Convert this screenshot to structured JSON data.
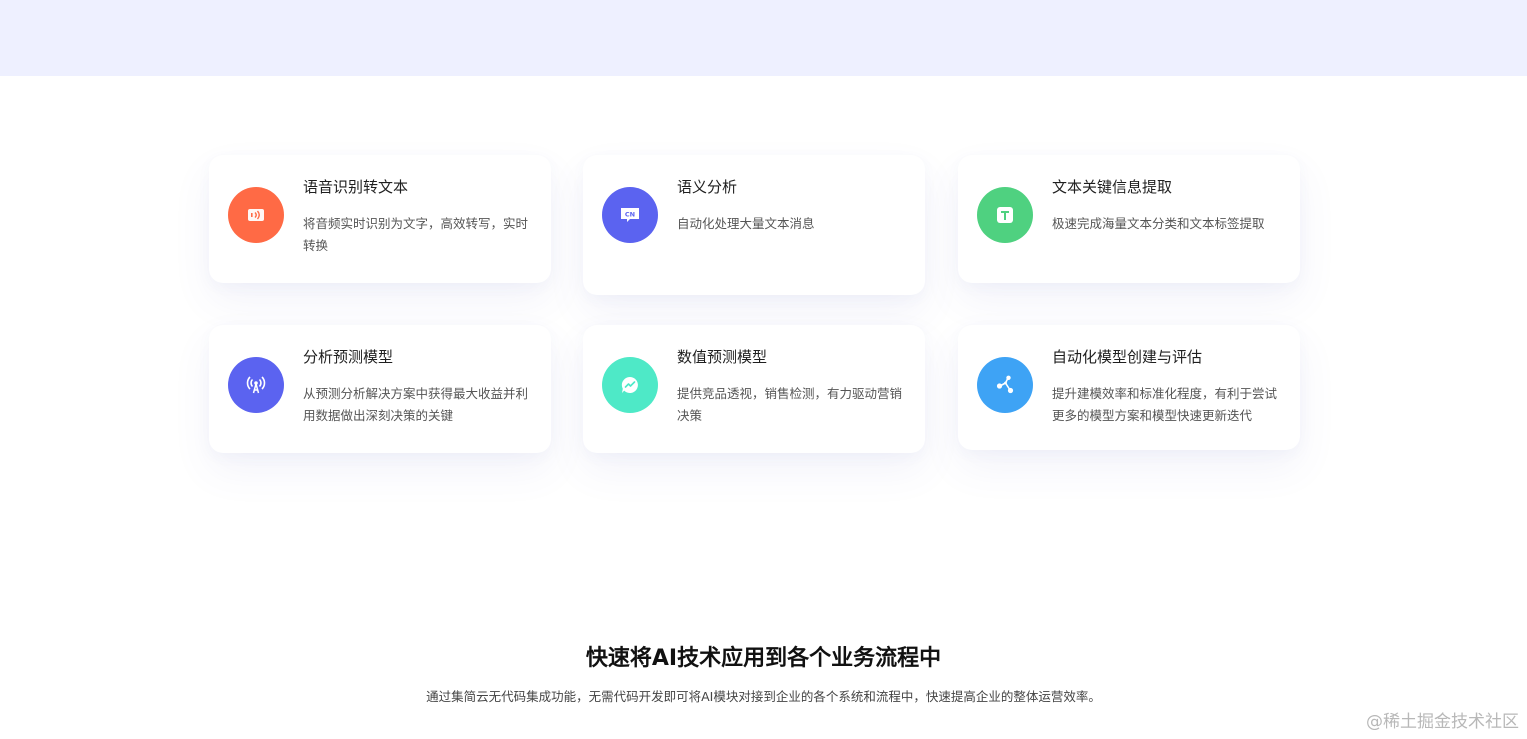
{
  "cards": [
    {
      "title": "语音识别转文本",
      "desc": "将音频实时识别为文字，高效转写，实时转换",
      "icon": "audio-wave-icon",
      "color": "#ff6a45"
    },
    {
      "title": "语义分析",
      "desc": "自动化处理大量文本消息",
      "icon": "cn-chat-icon",
      "color": "#5b63f0"
    },
    {
      "title": "文本关键信息提取",
      "desc": "极速完成海量文本分类和文本标签提取",
      "icon": "text-t-icon",
      "color": "#4fd180"
    },
    {
      "title": "分析预测模型",
      "desc": "从预测分析解决方案中获得最大收益并利用数据做出深刻决策的关键",
      "icon": "antenna-icon",
      "color": "#5b63f0"
    },
    {
      "title": "数值预测模型",
      "desc": "提供竞品透视，销售检测，有力驱动营销决策",
      "icon": "trend-chat-icon",
      "color": "#4ee9c7"
    },
    {
      "title": "自动化模型创建与评估",
      "desc": "提升建模效率和标准化程度，有利于尝试更多的模型方案和模型快速更新迭代",
      "icon": "share-nodes-icon",
      "color": "#3ea3f5"
    }
  ],
  "section": {
    "heading": "快速将AI技术应用到各个业务流程中",
    "subheading": "通过集简云无代码集成功能，无需代码开发即可将AI模块对接到企业的各个系统和流程中，快速提高企业的整体运营效率。"
  },
  "watermark": "@稀土掘金技术社区"
}
